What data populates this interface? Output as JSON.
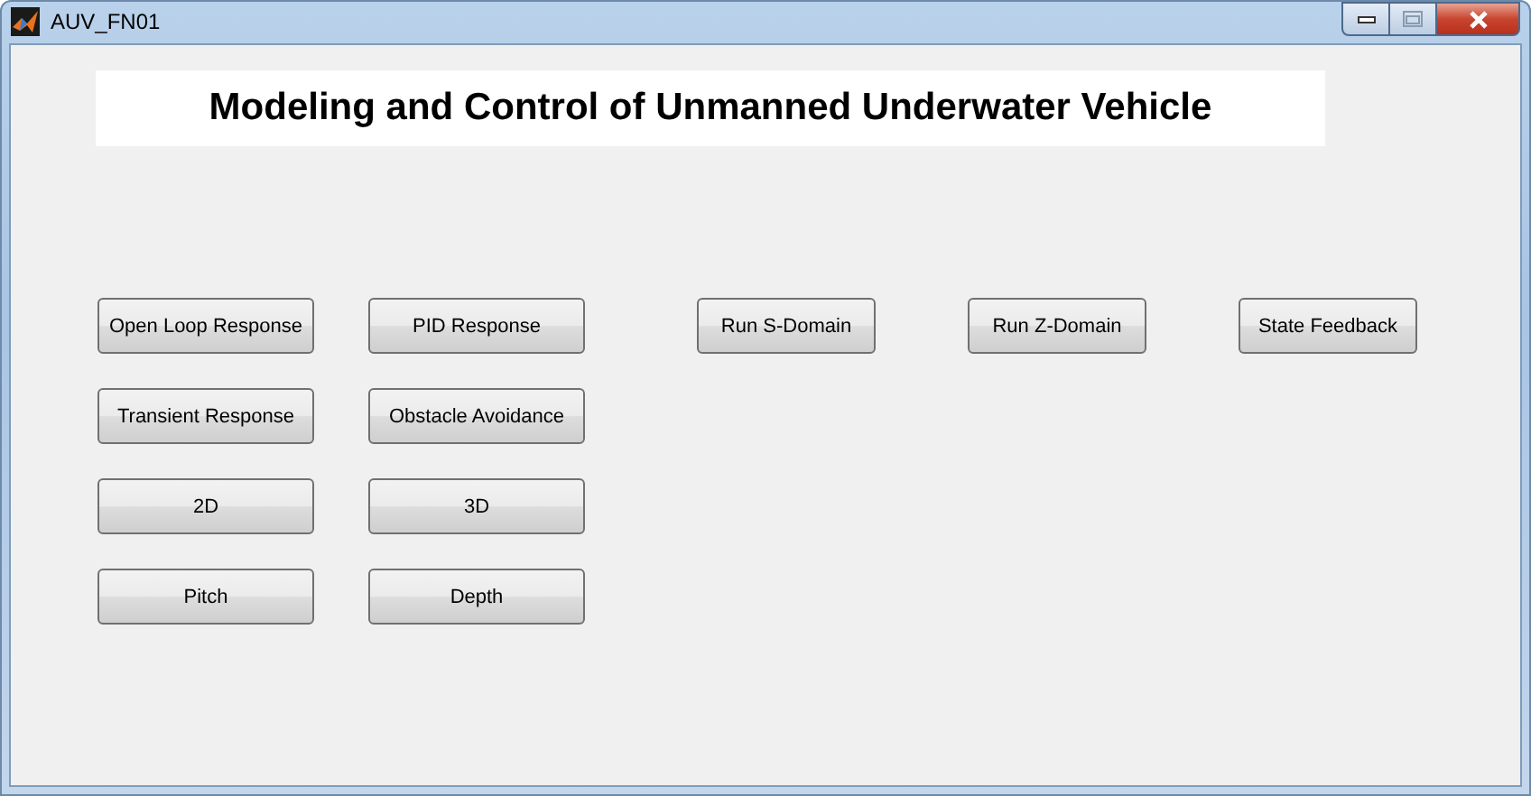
{
  "window": {
    "title": "AUV_FN01"
  },
  "heading": "Modeling and Control of Unmanned Underwater Vehicle",
  "button_rows": [
    [
      "Open Loop Response",
      "PID Response",
      "Run S-Domain",
      "Run Z-Domain",
      "State Feedback"
    ],
    [
      "Transient Response",
      "Obstacle Avoidance"
    ],
    [
      "2D",
      "3D"
    ],
    [
      "Pitch",
      "Depth"
    ]
  ]
}
